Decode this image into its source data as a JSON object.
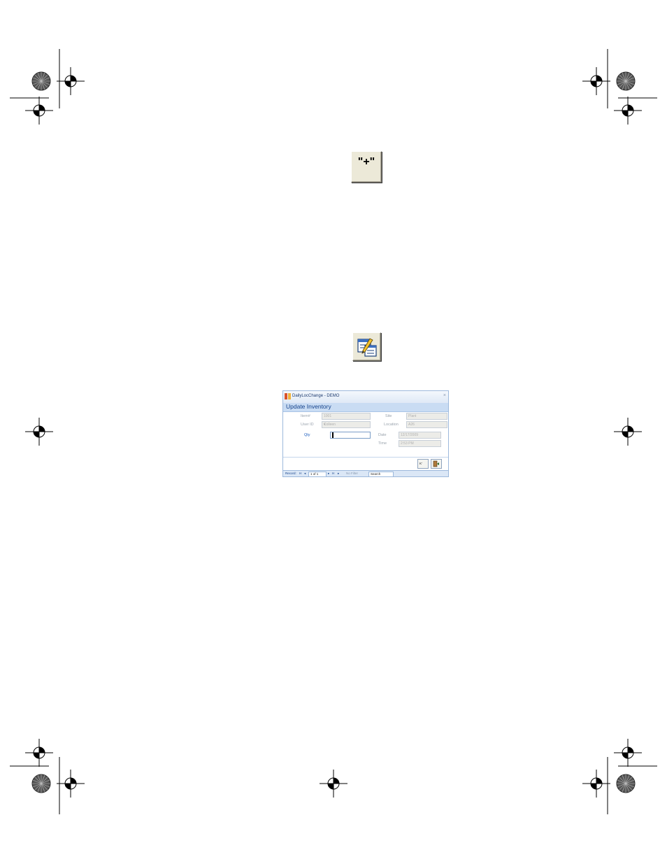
{
  "toolbar_buttons": {
    "insert_quotes_glyph": "\"+\"",
    "edit_form_icon": "form-edit-icon"
  },
  "form": {
    "window_title": "DailyLocChange - DEMO",
    "close_glyph": "×",
    "header": "Update Inventory",
    "labels": {
      "item": "Item#",
      "site": "Site",
      "user_id": "User ID",
      "location": "Location",
      "qty": "Qty",
      "date": "Date",
      "time": "Time"
    },
    "values": {
      "item": "1001",
      "site": "Plant",
      "user_id": "Colleen",
      "location": "A26",
      "qty": "",
      "date": "12/17/2009",
      "time": "2:53 PM"
    },
    "dropdown_glyph": "▾",
    "buttons": {
      "undo_label": "K'",
      "exit_icon": "exit-door-icon"
    },
    "navigation": {
      "record_label": "Record:",
      "first_glyph": "H",
      "prev_glyph": "◂",
      "position": "1 of 1",
      "next_glyph": "▸",
      "last_glyph": "H",
      "new_glyph": "▸",
      "filter_label": "No Filter",
      "search_label": "Search"
    }
  },
  "colors": {
    "accent": "#15428b",
    "header_bg": "#c9dcf3",
    "button_face": "#ece9d8"
  }
}
